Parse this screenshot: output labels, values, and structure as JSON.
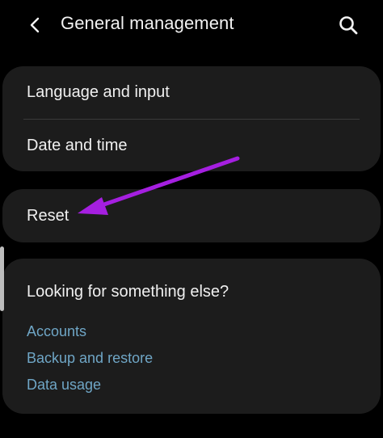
{
  "header": {
    "title": "General management",
    "back_icon": "chevron-left-icon",
    "search_icon": "search-icon"
  },
  "settings_group": {
    "items": [
      {
        "label": "Language and input"
      },
      {
        "label": "Date and time"
      }
    ]
  },
  "reset_item": {
    "label": "Reset"
  },
  "suggestions": {
    "heading": "Looking for something else?",
    "links": [
      {
        "label": "Accounts"
      },
      {
        "label": "Backup and restore"
      },
      {
        "label": "Data usage"
      }
    ]
  },
  "colors": {
    "background": "#000000",
    "card": "#1c1c1c",
    "link": "#6fa6c6",
    "annotation_arrow": "#a51fe0"
  }
}
